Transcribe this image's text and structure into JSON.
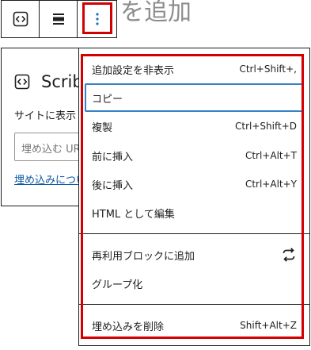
{
  "page": {
    "bg_title": "を追加"
  },
  "block": {
    "title": "Scrib",
    "description": "サイトに表示",
    "input_placeholder": "埋め込む URL",
    "help_link": "埋め込みについ"
  },
  "toolbar": {
    "embed_icon": "embed-code-icon",
    "align_icon": "align-icon",
    "more_icon": "vertical-ellipsis-icon"
  },
  "menu": {
    "groups": [
      {
        "items": [
          {
            "label": "追加設定を非表示",
            "shortcut": "Ctrl+Shift+,"
          },
          {
            "label": "コピー",
            "shortcut": "",
            "focused": true
          },
          {
            "label": "複製",
            "shortcut": "Ctrl+Shift+D"
          },
          {
            "label": "前に挿入",
            "shortcut": "Ctrl+Alt+T"
          },
          {
            "label": "後に挿入",
            "shortcut": "Ctrl+Alt+Y"
          },
          {
            "label": "HTML として編集",
            "shortcut": ""
          }
        ]
      },
      {
        "items": [
          {
            "label": "再利用ブロックに追加",
            "shortcut": "",
            "icon": "reusable-sync-icon"
          },
          {
            "label": "グループ化",
            "shortcut": ""
          }
        ]
      },
      {
        "items": [
          {
            "label": "埋め込みを削除",
            "shortcut": "Shift+Alt+Z"
          }
        ]
      }
    ]
  },
  "colors": {
    "highlight": "#d40000",
    "focus": "#3582c4",
    "link": "#0a58a6"
  }
}
